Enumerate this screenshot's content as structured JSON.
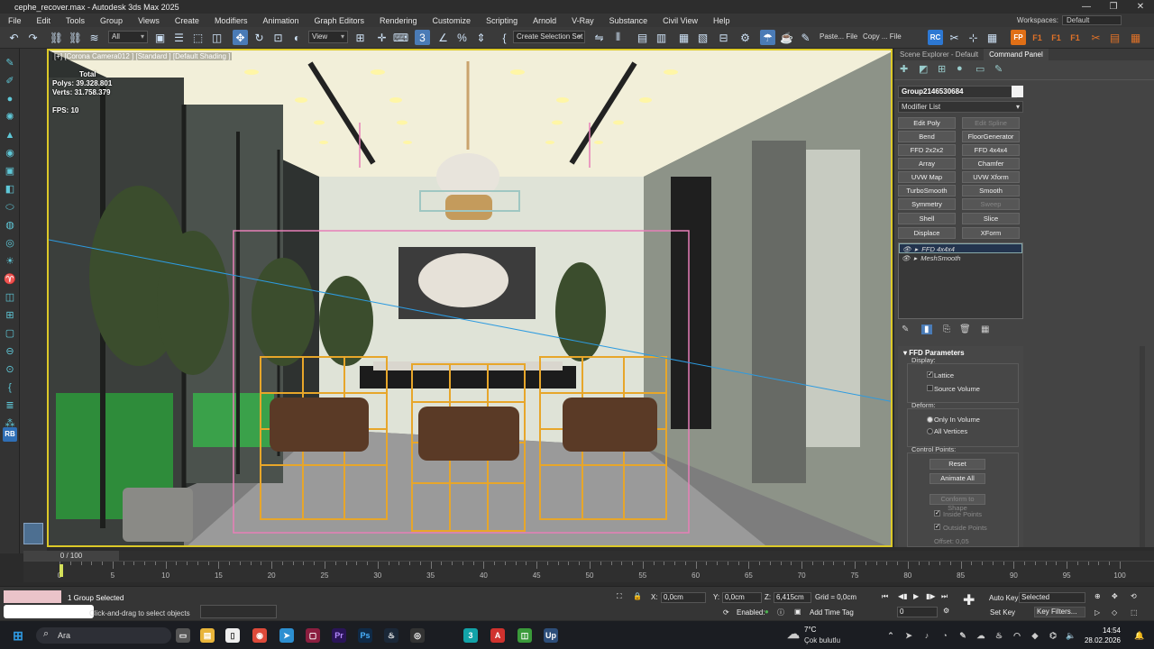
{
  "window": {
    "title": "cephe_recover.max - Autodesk 3ds Max 2025",
    "min": "—",
    "max": "❐",
    "close": "✕"
  },
  "menu": [
    "File",
    "Edit",
    "Tools",
    "Group",
    "Views",
    "Create",
    "Modifiers",
    "Animation",
    "Graph Editors",
    "Rendering",
    "Customize",
    "Scripting",
    "Arnold",
    "V-Ray",
    "Substance",
    "Civil View",
    "Help"
  ],
  "workspace": {
    "label": "Workspaces:",
    "value": "Default"
  },
  "toolbar": {
    "filter": "All",
    "view": "View",
    "selection_set": "Create Selection Set",
    "paste": "Paste... File",
    "copy": "Copy ... File",
    "rc": "RC",
    "fp": "FP",
    "f1": "F1",
    "f2": "F1",
    "f3": "F1"
  },
  "viewport": {
    "label": "[+] [Corona Camera012 ] [Standard ] [Default Shading ]",
    "stats_total": "Total",
    "stats_polys": "Polys: 39.328.801",
    "stats_verts": "Verts: 31.758.379",
    "stats_fps": "FPS:      10"
  },
  "panel": {
    "tab_scene": "Scene Explorer - Default",
    "tab_command": "Command Panel",
    "object_name": "Group2146530684",
    "modifier_list": "Modifier List",
    "modifier_buttons": [
      [
        "Edit Poly",
        "Edit Spline"
      ],
      [
        "Bend",
        "FloorGenerator"
      ],
      [
        "FFD 2x2x2",
        "FFD 4x4x4"
      ],
      [
        "Array",
        "Chamfer"
      ],
      [
        "UVW Map",
        "UVW Xform"
      ],
      [
        "TurboSmooth",
        "Smooth"
      ],
      [
        "Symmetry",
        "Sweep"
      ],
      [
        "Shell",
        "Slice"
      ],
      [
        "Displace",
        "XForm"
      ]
    ],
    "stack": [
      "FFD 4x4x4",
      "MeshSmooth"
    ],
    "ffd": {
      "title": "FFD Parameters",
      "display": "Display:",
      "lattice": "Lattice",
      "source_volume": "Source Volume",
      "deform": "Deform:",
      "only_in_volume": "Only In Volume",
      "all_vertices": "All Vertices",
      "control_points": "Control Points:",
      "reset": "Reset",
      "animate_all": "Animate All",
      "conform": "Conform to Shape",
      "inside_points": "Inside Points",
      "outside_points": "Outside Points",
      "offset": "Offset: 0,05"
    }
  },
  "timeline": {
    "slider": "0 / 100",
    "ticks": [
      "0",
      "5",
      "10",
      "15",
      "20",
      "25",
      "30",
      "35",
      "40",
      "45",
      "50",
      "55",
      "60",
      "65",
      "70",
      "75",
      "80",
      "85",
      "90",
      "95",
      "100"
    ]
  },
  "status": {
    "selected": "1 Group Selected",
    "hint": "Click-and-drag to select objects",
    "x_label": "X:",
    "x": "0,0cm",
    "y_label": "Y:",
    "y": "0,0cm",
    "z_label": "Z:",
    "z": "6,415cm",
    "grid": "Grid = 0,0cm",
    "enabled": "Enabled:",
    "add_time_tag": "Add Time Tag",
    "auto_key": "Auto Key",
    "set_key": "Set Key",
    "selected_dd": "Selected",
    "key_filters": "Key Filters...",
    "frame": "0"
  },
  "taskbar": {
    "search": "Ara",
    "weather_temp": "7°C",
    "weather_text": "Çok bulutlu",
    "time": "14:54",
    "date": "28.02.2026"
  },
  "colors": {
    "accent": "#4a7bb6",
    "viewport_border": "#dcc928",
    "selection": "#e7a62a"
  }
}
